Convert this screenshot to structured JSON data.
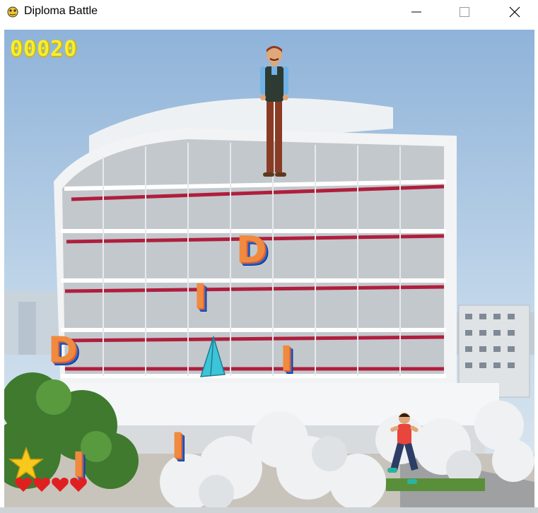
{
  "window": {
    "title": "Diploma Battle",
    "icon": "pygame-snake-icon",
    "controls": [
      "minimize-icon",
      "maximize-icon",
      "close-icon"
    ]
  },
  "hud": {
    "score": "00020",
    "bonus_icon": "star-icon",
    "lives": 4,
    "life_icon": "heart-icon"
  },
  "game": {
    "background": "university-building",
    "enemy": "professor",
    "player": "running-student",
    "projectile": "paper-airplane",
    "falling_letters": [
      "D",
      "I",
      "D",
      "I",
      "I",
      "I"
    ]
  },
  "colors": {
    "score": "#f6ee2c",
    "letter_face": "#f08a3e",
    "letter_shadow": "#1f5fd1",
    "heart": "#e02020",
    "star": "#f7c91a"
  }
}
